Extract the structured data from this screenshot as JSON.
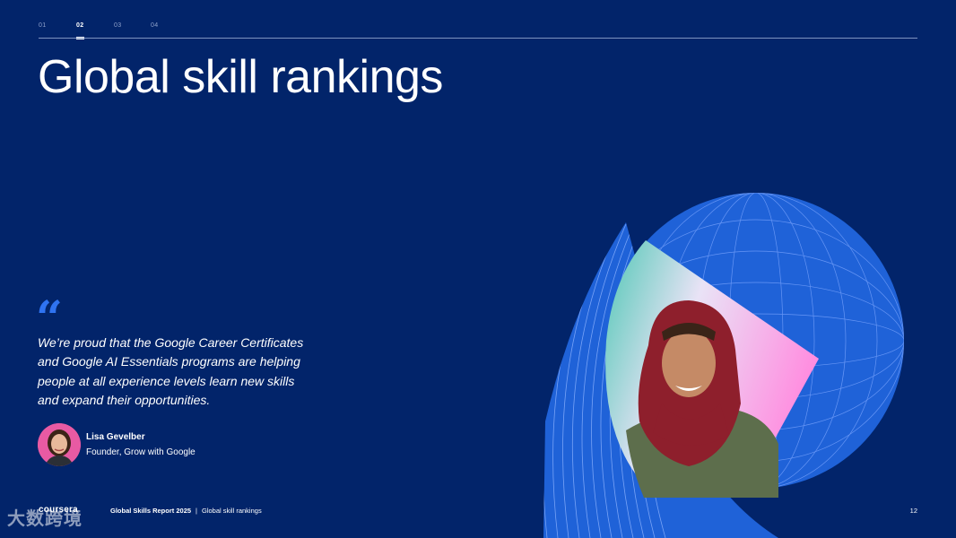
{
  "nav": {
    "steps": [
      "01",
      "02",
      "03",
      "04"
    ],
    "active": "02"
  },
  "title": "Global skill rankings",
  "quote": {
    "mark": "“",
    "text": "We’re proud that the Google Career Certificates and Google AI Essentials programs are helping people at all experience levels learn new skills and expand their opportunities."
  },
  "person": {
    "name": "Lisa Gevelber",
    "role": "Founder, Grow with Google"
  },
  "footer": {
    "logo": "coursera",
    "report": "Global Skills Report 2025",
    "separator": "|",
    "section": "Global skill rankings",
    "page": "12"
  },
  "watermark": "大数跨境",
  "colors": {
    "background": "#02246a",
    "accent": "#2f73f1",
    "art_blue": "#1f62d8"
  }
}
